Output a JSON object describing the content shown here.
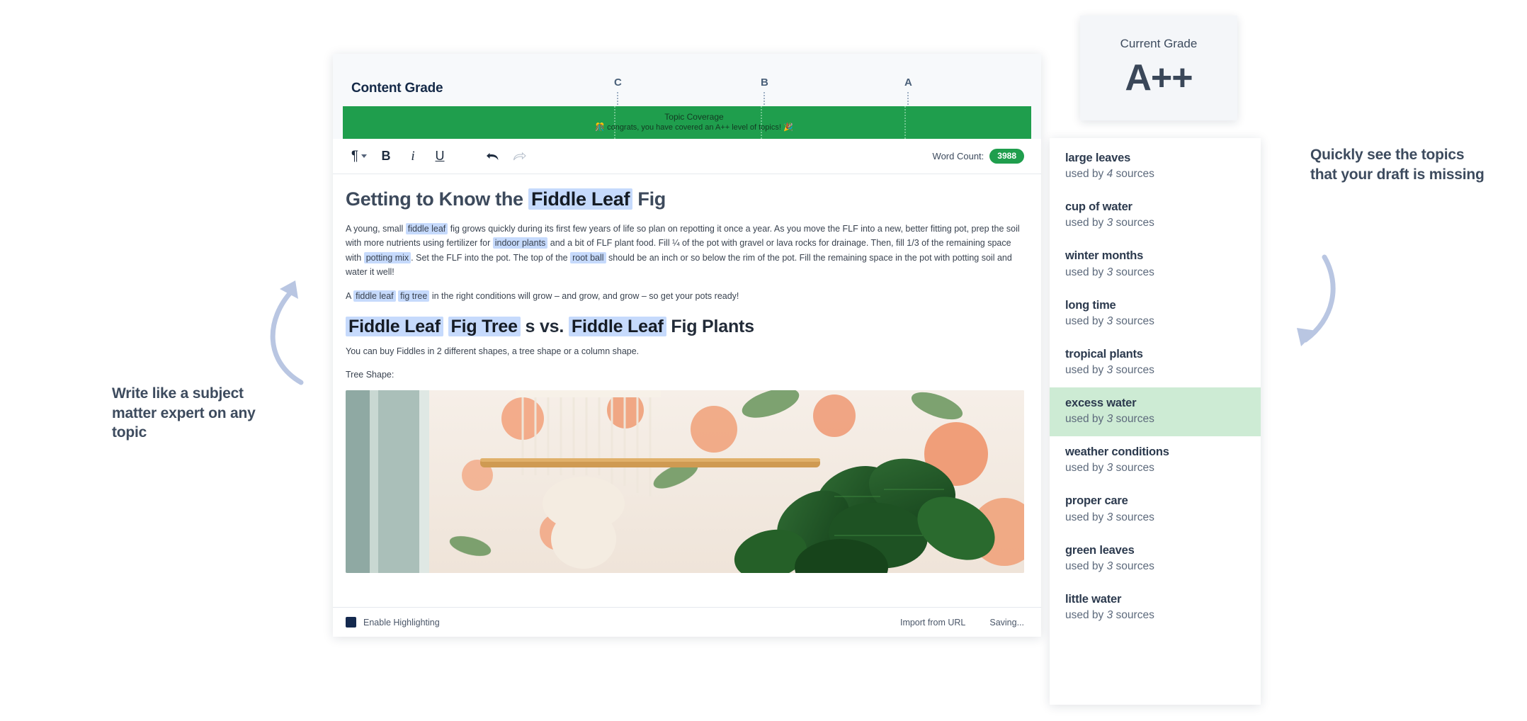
{
  "grade_header": {
    "title": "Content Grade",
    "ticks": [
      {
        "label": "C"
      },
      {
        "label": "B"
      },
      {
        "label": "A"
      }
    ],
    "coverage": {
      "title": "Topic Coverage",
      "message": "🎊 congrats, you have covered an A++ level of topics! 🎉",
      "fill_color": "#1f9e4d"
    }
  },
  "toolbar": {
    "paragraph_label": "¶",
    "bold_label": "B",
    "italic_label": "i",
    "underline_label": "U",
    "undo_label": "↰",
    "redo_label": "↱",
    "word_count_label": "Word Count:",
    "word_count_value": "3988",
    "word_count_color": "#1f9e4d"
  },
  "document": {
    "h1": {
      "pre": "Getting to Know the ",
      "highlight": "Fiddle Leaf",
      "post": " Fig"
    },
    "p1": {
      "s1": "A young, small ",
      "h1": "fiddle leaf",
      "s2": " fig grows quickly during its first few years of life so plan on repotting it once a year. As you move the FLF into a new, better fitting pot, prep the soil with more nutrients using fertilizer for ",
      "h2": "indoor plants",
      "s3": " and a bit of FLF plant food. Fill ¼ of the pot with gravel or lava rocks for drainage. Then, fill 1/3 of the remaining space with ",
      "h3": "potting mix",
      "s4": ". Set the FLF into the pot. The top of the ",
      "h4": "root ball",
      "s5": " should be an inch or so below the rim of the pot. Fill the remaining space in the pot with potting soil and water it well!"
    },
    "p2": {
      "s1": "A ",
      "h1": "fiddle leaf",
      "s2": " ",
      "h2": "fig tree",
      "s3": " in the right conditions will grow – and grow, and grow – so get your pots ready!"
    },
    "h2": {
      "h1": "Fiddle Leaf",
      "sp1": " ",
      "h2": "Fig Tree",
      "mid": " s vs. ",
      "h3": "Fiddle Leaf",
      "post": " Fig Plants"
    },
    "p3": "You can buy Fiddles in 2 different shapes, a tree shape or a column shape.",
    "p4": "Tree Shape:"
  },
  "editor_footer": {
    "highlight_toggle": "Enable Highlighting",
    "import_url": "Import from URL",
    "saving": "Saving..."
  },
  "grade_card": {
    "label": "Current Grade",
    "value": "A++"
  },
  "topics": [
    {
      "name": "large leaves",
      "used_by": "used by ",
      "count": "4",
      "sources": " sources",
      "active": false
    },
    {
      "name": "cup of water",
      "used_by": "used by ",
      "count": "3",
      "sources": " sources",
      "active": false
    },
    {
      "name": "winter months",
      "used_by": "used by ",
      "count": "3",
      "sources": " sources",
      "active": false
    },
    {
      "name": "long time",
      "used_by": "used by ",
      "count": "3",
      "sources": " sources",
      "active": false
    },
    {
      "name": "tropical plants",
      "used_by": "used by ",
      "count": "3",
      "sources": " sources",
      "active": false
    },
    {
      "name": "excess water",
      "used_by": "used by ",
      "count": "3",
      "sources": " sources",
      "active": true
    },
    {
      "name": "weather conditions",
      "used_by": "used by ",
      "count": "3",
      "sources": " sources",
      "active": false
    },
    {
      "name": "proper care",
      "used_by": "used by ",
      "count": "3",
      "sources": " sources",
      "active": false
    },
    {
      "name": "green leaves",
      "used_by": "used by ",
      "count": "3",
      "sources": " sources",
      "active": false
    },
    {
      "name": "little water",
      "used_by": "used by ",
      "count": "3",
      "sources": " sources",
      "active": false
    }
  ],
  "annotations": {
    "left": "Write like a subject matter expert on any topic",
    "right": "Quickly see the topics that your draft is missing"
  }
}
